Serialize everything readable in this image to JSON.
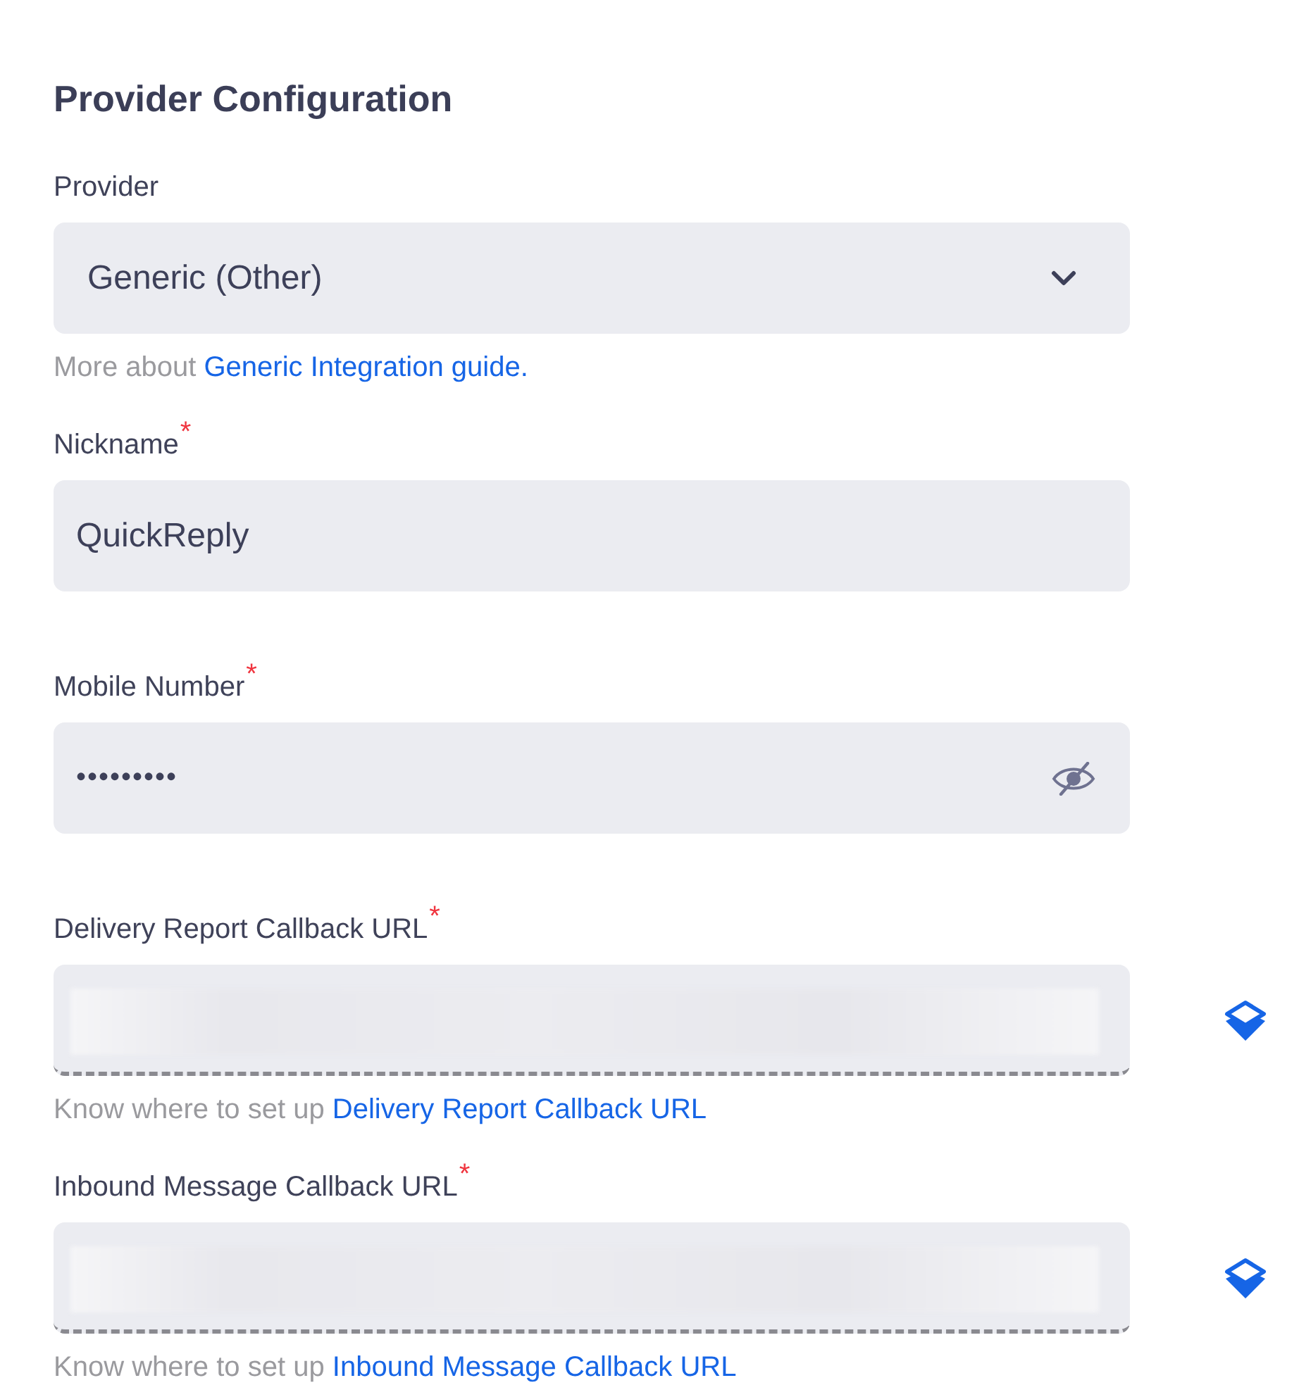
{
  "title": "Provider Configuration",
  "fields": [
    {
      "kind": "select",
      "label": "Provider",
      "value": "Generic (Other)",
      "help": "More about",
      "help_link": "Generic Integration guide."
    },
    {
      "kind": "text",
      "label": "Nickname",
      "required_mark": "*",
      "value": "QuickReply"
    },
    {
      "kind": "password",
      "label": "Mobile Number",
      "required_mark": "*",
      "value": "•••••••••",
      "visible": false
    },
    {
      "kind": "url",
      "label": "Delivery Report Callback URL",
      "required_mark": "*",
      "help": "Know where to set up",
      "help_link": "Delivery Report Callback URL"
    },
    {
      "kind": "url",
      "label": "Inbound Message Callback URL",
      "required_mark": "*",
      "help": "Know where to set up",
      "help_link": "Inbound Message Callback URL"
    }
  ]
}
